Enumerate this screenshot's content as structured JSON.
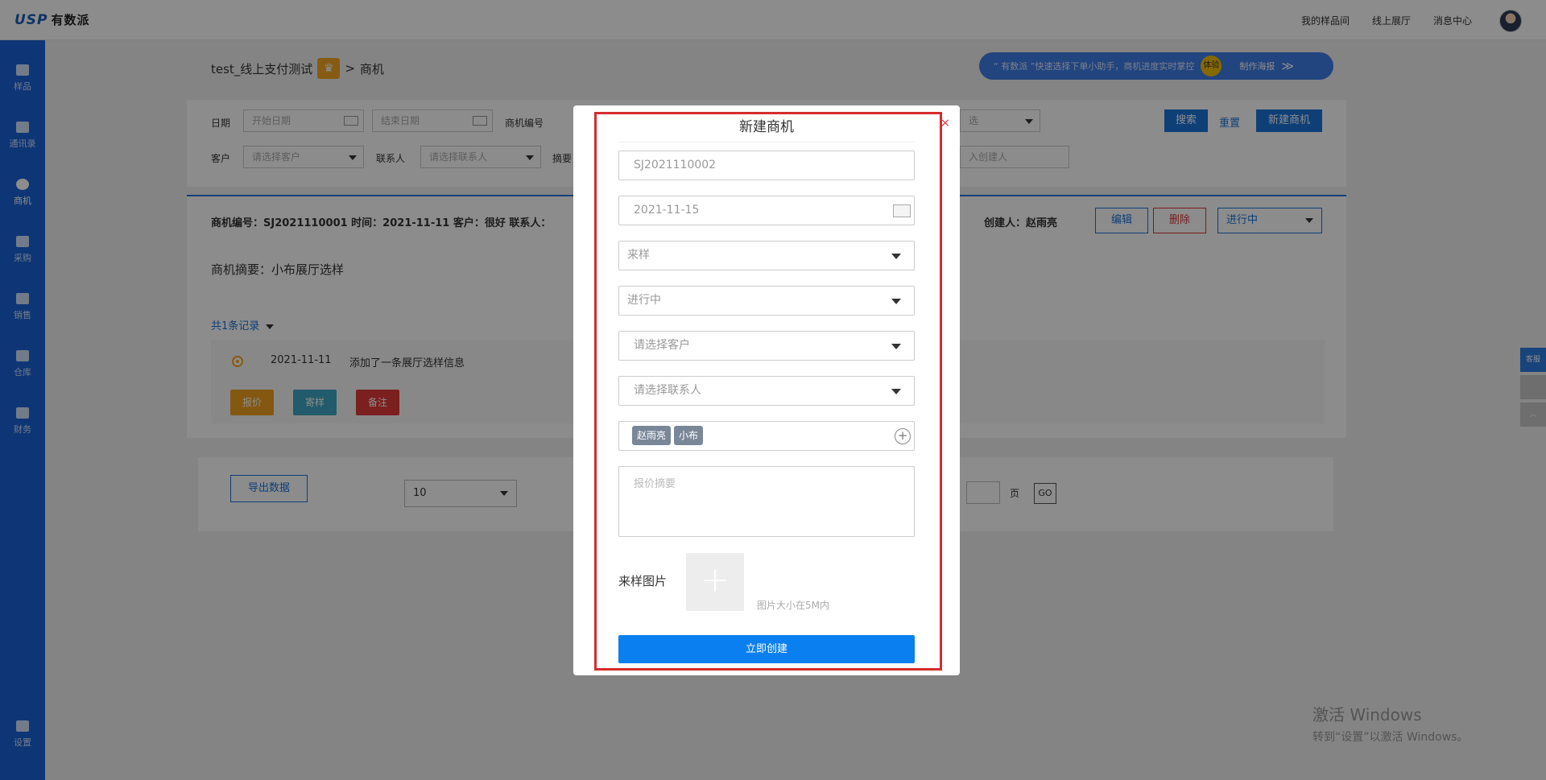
{
  "topbar": {
    "logo_brand": "USP",
    "logo_text": "有数派",
    "links": [
      "我的样品间",
      "线上展厅",
      "消息中心"
    ]
  },
  "sidebar": {
    "items": [
      {
        "label": "样品"
      },
      {
        "label": "通讯录"
      },
      {
        "label": "商机"
      },
      {
        "label": "采购"
      },
      {
        "label": "销售"
      },
      {
        "label": "仓库"
      },
      {
        "label": "财务"
      },
      {
        "label": "设置"
      }
    ],
    "active": "商机"
  },
  "breadcrumb": {
    "project": "test_线上支付测试",
    "sep": ">",
    "current": "商机",
    "crown": "♛"
  },
  "promo": {
    "text": "“ 有数派 ”快速选择下单小助手，商机进度实时掌控",
    "badge": "体验",
    "action": "制作海报",
    "arrow": "≫"
  },
  "filters": {
    "date_label": "日期",
    "start_placeholder": "开始日期",
    "end_placeholder": "结束日期",
    "code_label": "商机编号",
    "select_placeholder": "选",
    "customer_label": "客户",
    "customer_placeholder": "请选择客户",
    "contact_label": "联系人",
    "contact_placeholder": "请选择联系人",
    "summary_label": "摘要",
    "creator_placeholder": "入创建人",
    "search": "搜索",
    "reset": "重置",
    "create": "新建商机"
  },
  "detail": {
    "header": "商机编号：SJ2021110001  时间：2021-11-11  客户：很好  联系人：",
    "creator": "创建人：赵雨亮",
    "edit": "编辑",
    "delete": "删除",
    "status": "进行中",
    "summary": "商机摘要：小布展厅选样",
    "records": "共1条记录",
    "log_date": "2021-11-11",
    "log_text": "添加了一条展厅选样信息",
    "btn_quote": "报价",
    "btn_sample": "寄样",
    "btn_note": "备注"
  },
  "pager": {
    "export": "导出数据",
    "page_size": "10",
    "page_unit": "页",
    "go": "GO"
  },
  "float_tools": {
    "service": "客服"
  },
  "watermark": {
    "line1": "激活 Windows",
    "line2": "转到“设置”以激活 Windows。"
  },
  "modal": {
    "title": "新建商机",
    "close": "×",
    "code_value": "SJ2021110002",
    "date_value": "2021-11-15",
    "type_value": "来样",
    "status_value": "进行中",
    "customer_placeholder": "请选择客户",
    "contact_placeholder": "请选择联系人",
    "tags": [
      "赵雨亮",
      "小布"
    ],
    "add_tag": "+",
    "summary_placeholder": "报价摘要",
    "image_label": "来样图片",
    "image_plus": "+",
    "image_hint": "图片大小在5M内",
    "submit": "立即创建"
  }
}
